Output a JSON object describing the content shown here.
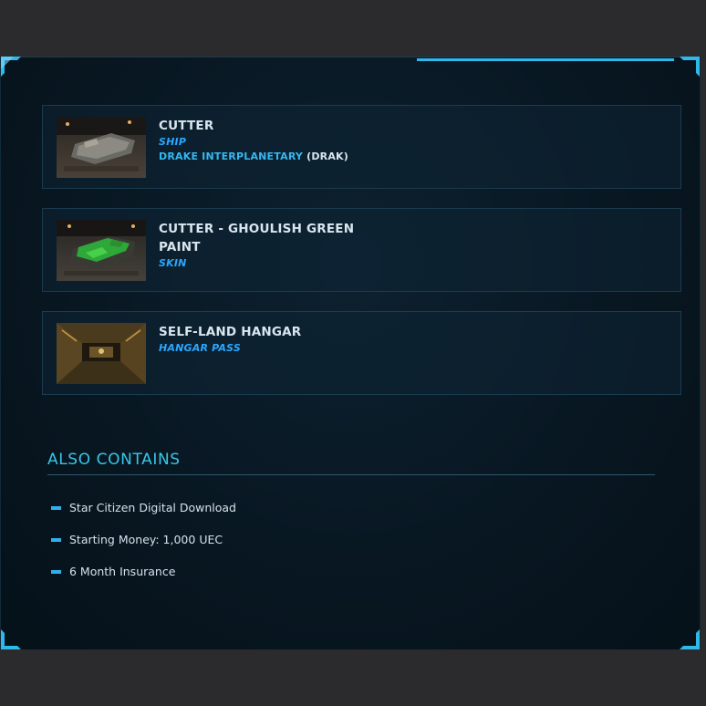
{
  "items": [
    {
      "title": "Cutter",
      "type": "Ship",
      "manufacturer": "Drake Interplanetary",
      "manufacturer_code": "(DRAK)",
      "thumb_icon": "cutter-ship-thumbnail"
    },
    {
      "title": "Cutter - Ghoulish Green Paint",
      "type": "Skin",
      "thumb_icon": "green-paint-ship-thumbnail"
    },
    {
      "title": "Self-Land Hangar",
      "type": "Hangar pass",
      "thumb_icon": "hangar-thumbnail"
    }
  ],
  "also_contains": {
    "heading": "ALSO CONTAINS",
    "entries": [
      "Star Citizen Digital Download",
      "Starting Money: 1,000 UEC",
      "6 Month Insurance"
    ]
  },
  "colors": {
    "accent": "#2fb8e8",
    "heading": "#38c6e8",
    "type_text": "#2aa7ff",
    "panel_bg": "#081722"
  }
}
